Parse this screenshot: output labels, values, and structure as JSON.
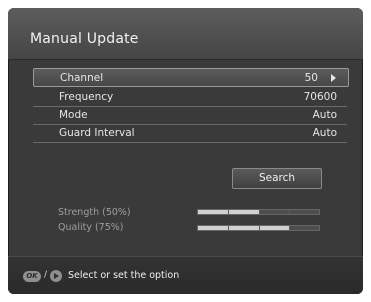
{
  "title": "Manual Update",
  "rows": [
    {
      "label": "Channel",
      "value": "50"
    },
    {
      "label": "Frequency",
      "value": "70600"
    },
    {
      "label": "Mode",
      "value": "Auto"
    },
    {
      "label": "Guard Interval",
      "value": "Auto"
    }
  ],
  "search_label": "Search",
  "meters": [
    {
      "label": "Strength (50%)",
      "level": 0.5
    },
    {
      "label": "Quality (75%)",
      "level": 0.75
    }
  ],
  "footer": {
    "ok_key": "OK",
    "separator": "/",
    "hint": "Select or set the option"
  }
}
